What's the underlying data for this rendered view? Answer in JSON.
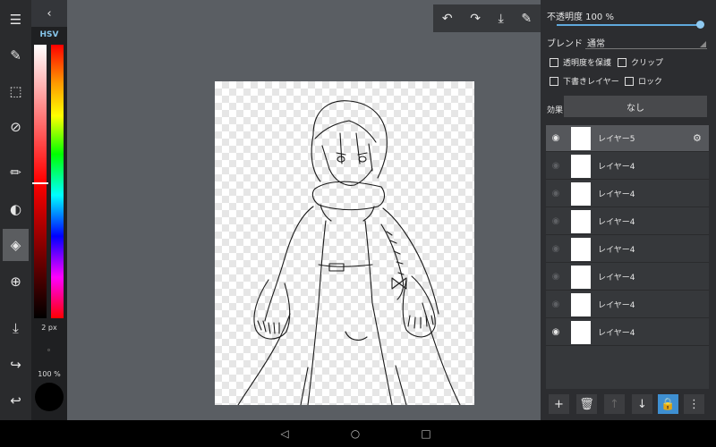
{
  "toolbar": {
    "tools": [
      {
        "name": "menu-icon",
        "glyph": "☰"
      },
      {
        "name": "edit-icon",
        "glyph": "✎"
      },
      {
        "name": "select-rect-icon",
        "glyph": "⬚"
      },
      {
        "name": "transform-icon",
        "glyph": "⊘"
      },
      {
        "name": "brush-icon",
        "glyph": "✏"
      },
      {
        "name": "palette-icon",
        "glyph": "🎨"
      },
      {
        "name": "layers-icon",
        "glyph": "◈"
      },
      {
        "name": "grid-icon",
        "glyph": "⊕"
      },
      {
        "name": "eyedropper-icon",
        "glyph": "⤓"
      },
      {
        "name": "redo-icon",
        "glyph": "↪"
      },
      {
        "name": "undo-icon",
        "glyph": "↩"
      }
    ]
  },
  "colorpanel": {
    "mode_label": "HSV",
    "brush_size": "2 px",
    "opacity": "100 %",
    "current_color": "#000000"
  },
  "topbar": {
    "icons": [
      "undo-icon",
      "redo-icon",
      "eyedropper-icon",
      "pen-icon"
    ]
  },
  "layer_props": {
    "opacity_text": "不透明度 100 %",
    "blend_label": "ブレンド",
    "blend_value": "通常",
    "checkboxes": {
      "preserve_transparency": "透明度を保護",
      "clip": "クリップ",
      "draft_layer": "下書きレイヤー",
      "lock": "ロック"
    },
    "effect_label": "効果",
    "effect_value": "なし"
  },
  "layers": [
    {
      "name": "レイヤー5",
      "visible": true,
      "selected": true
    },
    {
      "name": "レイヤー4",
      "visible": false,
      "selected": false
    },
    {
      "name": "レイヤー4",
      "visible": false,
      "selected": false
    },
    {
      "name": "レイヤー4",
      "visible": false,
      "selected": false
    },
    {
      "name": "レイヤー4",
      "visible": false,
      "selected": false
    },
    {
      "name": "レイヤー4",
      "visible": false,
      "selected": false
    },
    {
      "name": "レイヤー4",
      "visible": false,
      "selected": false
    },
    {
      "name": "レイヤー4",
      "visible": true,
      "selected": false
    }
  ],
  "layer_actions": [
    "add-layer-icon",
    "trash-icon",
    "move-up-icon",
    "move-down-icon",
    "lock-icon",
    "more-icon"
  ],
  "colors": {
    "accent": "#3e8fd1",
    "toolbar_bg": "#2a2b2d",
    "workspace_bg": "#5a5e63"
  }
}
